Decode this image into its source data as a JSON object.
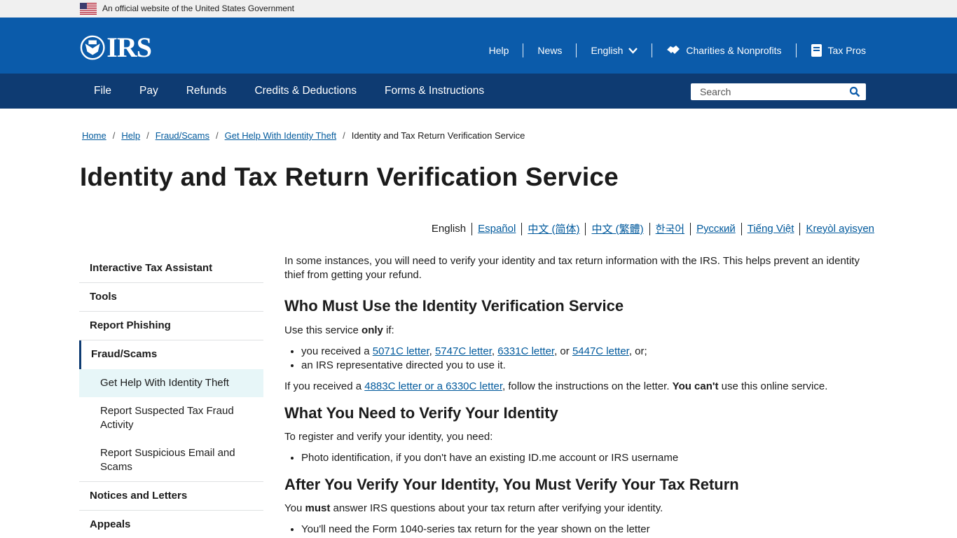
{
  "gov_banner": {
    "text": "An official website of the United States Government"
  },
  "header": {
    "logo_text": "IRS",
    "utility": [
      {
        "label": "Help"
      },
      {
        "label": "News"
      },
      {
        "label": "English"
      },
      {
        "label": "Charities & Nonprofits"
      },
      {
        "label": "Tax Pros"
      }
    ]
  },
  "nav": {
    "items": [
      "File",
      "Pay",
      "Refunds",
      "Credits & Deductions",
      "Forms & Instructions"
    ],
    "search_placeholder": "Search"
  },
  "breadcrumb": {
    "items": [
      "Home",
      "Help",
      "Fraud/Scams",
      "Get Help With Identity Theft"
    ],
    "current": "Identity and Tax Return Verification Service",
    "sep": "/"
  },
  "page_title": "Identity and Tax Return Verification Service",
  "languages": {
    "active": "English",
    "others": [
      "Español",
      "中文 (简体)",
      "中文 (繁體)",
      "한국어",
      "Русский",
      "Tiếng Việt",
      "Kreyòl ayisyen"
    ]
  },
  "sidebar": {
    "items": [
      "Interactive Tax Assistant",
      "Tools",
      "Report Phishing"
    ],
    "active": "Fraud/Scams",
    "sub": [
      "Get Help With Identity Theft",
      "Report Suspected Tax Fraud Activity",
      "Report Suspicious Email and Scams"
    ],
    "after": [
      "Notices and Letters",
      "Appeals"
    ]
  },
  "content": {
    "intro": "In some instances, you will need to verify your identity and tax return information with the IRS. This helps prevent an identity thief from getting your refund.",
    "h1": "Who Must Use the Identity Verification Service",
    "use_pre": "Use this service ",
    "use_bold": "only",
    "use_post": " if:",
    "li1_pre": "you received a ",
    "li1_links": [
      "5071C letter",
      "5747C letter",
      "6331C letter",
      "5447C letter"
    ],
    "li1_sep1": ", ",
    "li1_sep2": ", ",
    "li1_sep3": ", or ",
    "li1_post": ", or;",
    "li2": "an IRS representative directed you to use it.",
    "if_pre": "If you received a ",
    "if_link": "4883C letter or a 6330C letter",
    "if_mid": ", follow the instructions on the letter. ",
    "if_bold": "You can't",
    "if_post": " use this online service.",
    "h2": "What You Need to Verify Your Identity",
    "need": "To register and verify your identity, you need:",
    "need_li": "Photo identification, if you don't have an existing ID.me account or IRS username",
    "h3": "After You Verify Your Identity, You Must Verify Your Tax Return",
    "must_pre": "You ",
    "must_bold": "must",
    "must_post": " answer IRS questions about your tax return after verifying your identity.",
    "need2_li": "You'll need the Form 1040-series tax return for the year shown on the letter"
  },
  "colors": {
    "header_blue": "#0b5baa",
    "nav_navy": "#0e3b72",
    "link": "#00599c",
    "sidebar_current_bg": "#e7f6f8"
  }
}
